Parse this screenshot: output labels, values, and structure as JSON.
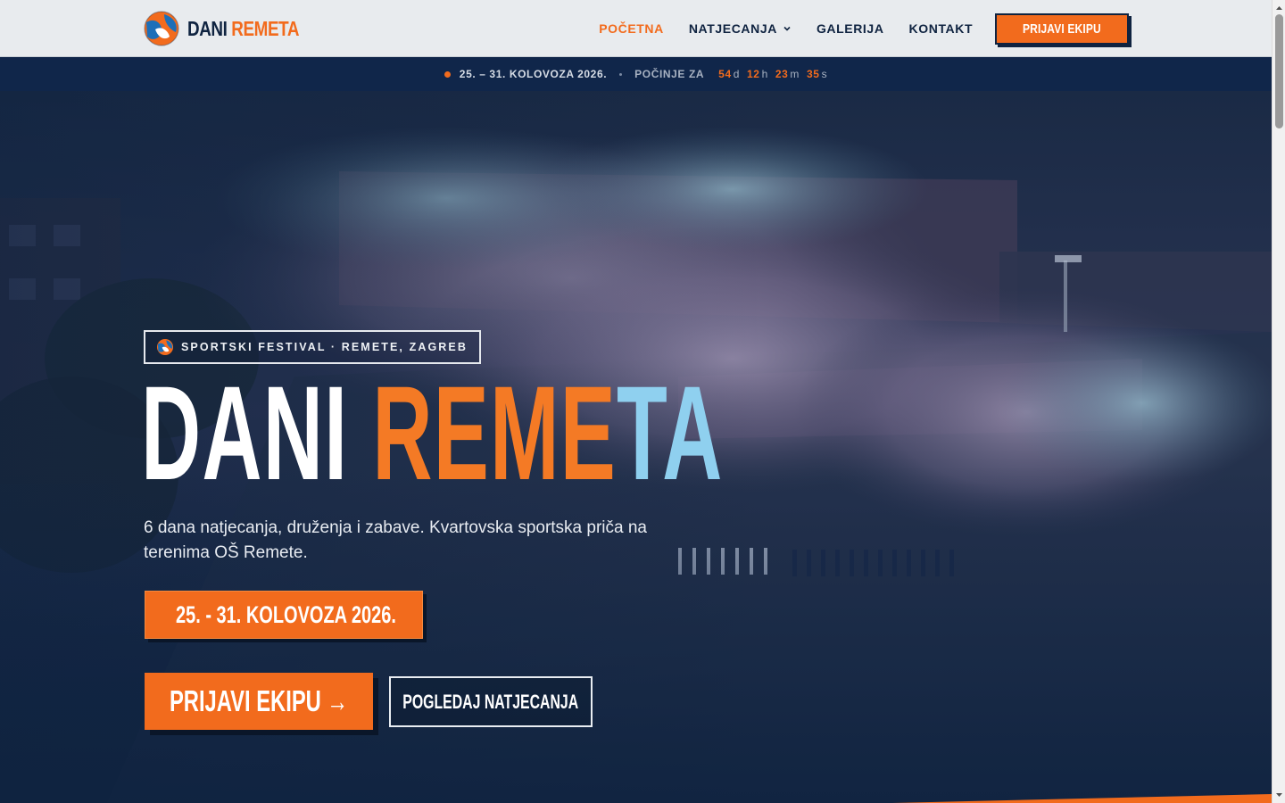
{
  "header": {
    "logo": {
      "word1": "DANI",
      "word2": "REMETA"
    },
    "nav": [
      {
        "label": "POČETNA",
        "active": true
      },
      {
        "label": "NATJECANJA",
        "has_dropdown": true
      },
      {
        "label": "GALERIJA"
      },
      {
        "label": "KONTAKT"
      }
    ],
    "cta_label": "PRIJAVI EKIPU"
  },
  "strip": {
    "dates": "25. – 31. KOLOVOZA 2026.",
    "starts_label": "POČINJE ZA",
    "countdown": {
      "days": "54",
      "days_unit": "d",
      "hours": "12",
      "hours_unit": "h",
      "minutes": "23",
      "minutes_unit": "m",
      "seconds": "35",
      "seconds_unit": "s"
    }
  },
  "hero": {
    "badge": "SPORTSKI FESTIVAL · REMETE, ZAGREB",
    "title": {
      "part1": "DANI ",
      "part2": "REME",
      "part3": "TA"
    },
    "subtitle": "6 dana natjecanja, druženja i zabave. Kvartovska sportska priča na terenima OŠ Remete.",
    "date_box": "25. - 31. KOLOVOZA 2026.",
    "primary_button": "PRIJAVI EKIPU →",
    "secondary_button": "POGLEDAJ NATJECANJA"
  },
  "colors": {
    "accent": "#f26b1d",
    "navy": "#0f2340",
    "light_blue": "#8fd0ef"
  },
  "icons": {
    "logo": "ball-logo-icon",
    "dropdown": "chevron-down-icon",
    "calendar": "calendar-icon"
  }
}
